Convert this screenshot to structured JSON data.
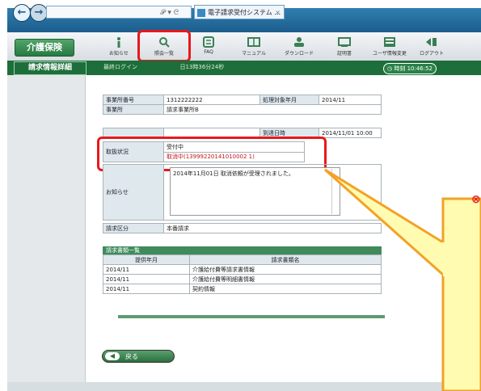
{
  "browser": {
    "address_glyphs": "𝒫 ▾ ᘓ",
    "tab_title": "電子請求受付システム …",
    "tab_close": "×",
    "back_glyph": "←",
    "forward_glyph": "→"
  },
  "app": {
    "logo": "介護保険",
    "toolbar": [
      {
        "label": "お知らせ",
        "icon": "info-icon"
      },
      {
        "label": "照会一覧",
        "icon": "search-icon"
      },
      {
        "label": "FAQ",
        "icon": "faq-icon"
      },
      {
        "label": "マニュアル",
        "icon": "manual-icon"
      },
      {
        "label": "ダウンロード",
        "icon": "download-icon"
      },
      {
        "label": "証明書",
        "icon": "certificate-icon"
      },
      {
        "label": "ユーザ情報変更",
        "icon": "user-settings-icon"
      },
      {
        "label": "ログアウト",
        "icon": "logout-icon"
      }
    ],
    "header_title": "請求情報詳細",
    "login_text": "最終ログイン",
    "login_time_tail": "日13時36分24秒",
    "session_label": "時刻",
    "session_time": "10:46:52"
  },
  "detail": {
    "office_number_label": "事業所番号",
    "office_number": "1312222222",
    "office_label": "事業所",
    "office_name": "請求事業所B",
    "period_label": "処理対象年月",
    "period": "2014/11",
    "received_label": "到達日時",
    "received": "2014/11/01 10:00",
    "status_label": "取扱状況",
    "status_value": "受付中",
    "status_detail": "取消中(13999220141010002 1)",
    "notice_label": "お知らせ",
    "notice_text": "2014年11月01日 取消依頼が受理されました。",
    "claim_type_label": "請求区分",
    "claim_type": "本番請求"
  },
  "docs": {
    "section_title": "請求書類一覧",
    "col_period": "提供年月",
    "col_name": "請求書類名",
    "rows": [
      {
        "period": "2014/11",
        "name": "介護給付費等請求書情報"
      },
      {
        "period": "2014/11",
        "name": "介護給付費等明細書情報"
      },
      {
        "period": "2014/11",
        "name": "契約情報"
      }
    ]
  },
  "back_button": "戻る",
  "colors": {
    "highlight": "#e8181c",
    "brand_green": "#1d6e3a",
    "callout_fill": "#fffbb0",
    "callout_border": "#f2a227"
  }
}
